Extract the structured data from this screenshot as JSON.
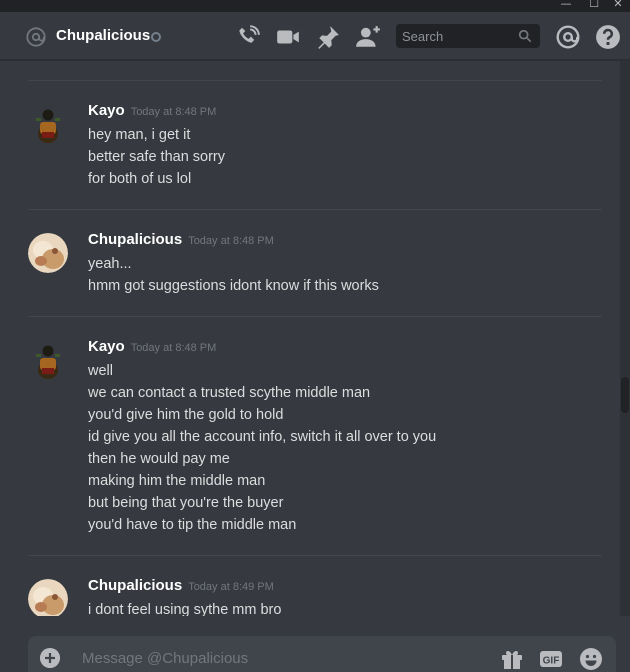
{
  "window": {
    "minimize": "—",
    "maximize": "☐",
    "close": "✕"
  },
  "header": {
    "channel_name": "Chupalicious",
    "search_placeholder": "Search",
    "icons": [
      "at-icon",
      "status-icon",
      "voice-call-icon",
      "video-call-icon",
      "pin-icon",
      "add-friend-icon",
      "search-icon",
      "mentions-icon",
      "help-icon"
    ]
  },
  "messages": [
    {
      "author": "Kayo",
      "timestamp": "Today at 8:48 PM",
      "lines": [
        "hey man, i get it",
        "better safe than sorry",
        "for both of us lol"
      ]
    },
    {
      "author": "Chupalicious",
      "timestamp": "Today at 8:48 PM",
      "lines": [
        "yeah...",
        "hmm got suggestions idont know if this works"
      ]
    },
    {
      "author": "Kayo",
      "timestamp": "Today at 8:48 PM",
      "lines": [
        "well",
        "we can contact a trusted scythe middle man",
        "you'd give him the gold to hold",
        "id give you all the account info, switch it all over to you",
        "then he would pay me",
        "making him the middle man",
        "but being that you're the buyer",
        "you'd have to tip the middle man"
      ]
    },
    {
      "author": "Chupalicious",
      "timestamp": "Today at 8:49 PM",
      "lines": [
        "i dont feel using sythe mm bro"
      ]
    }
  ],
  "composer": {
    "placeholder": "Message @Chupalicious",
    "icons": [
      "plus-icon",
      "gift-icon",
      "gif-icon",
      "emoji-icon"
    ],
    "gif_label": "GIF"
  },
  "colors": {
    "background": "#36393f",
    "header_text": "#ffffff",
    "message_text": "#dcddde",
    "timestamp": "#72767d",
    "composer_bg": "#40444b"
  }
}
